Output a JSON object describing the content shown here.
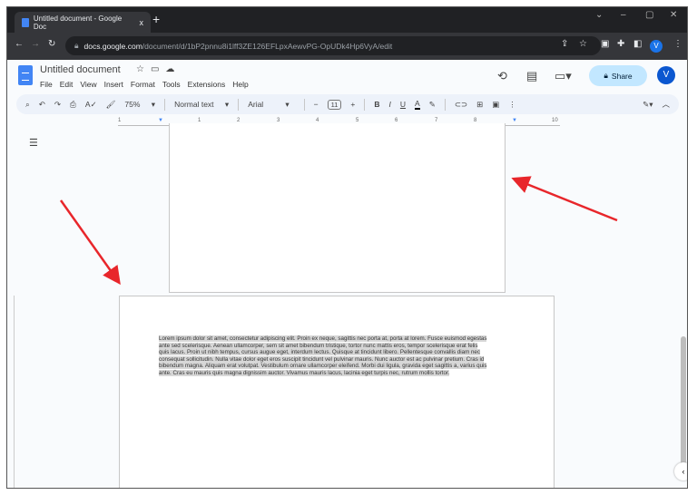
{
  "browser": {
    "tab_title": "Untitled document - Google Doc",
    "new_tab": "+",
    "close": "x",
    "window_controls": [
      "⌄",
      "–",
      "▢",
      "✕"
    ],
    "url_host": "docs.google.com",
    "url_path": "/document/d/1bP2pnnu8i1lff3ZE126EFLpxAewvPG-OpUDk4Hp6VyA/edit",
    "profile": "V"
  },
  "doc": {
    "title": "Untitled document",
    "menu": [
      "File",
      "Edit",
      "View",
      "Insert",
      "Format",
      "Tools",
      "Extensions",
      "Help"
    ],
    "share": "Share",
    "avatar": "V"
  },
  "toolbar": {
    "zoom": "75%",
    "style": "Normal text",
    "font": "Arial",
    "size": "11",
    "minus": "−",
    "plus": "+",
    "bold": "B",
    "italic": "I",
    "underline": "U",
    "color": "A"
  },
  "ruler": [
    "1",
    "1",
    "2",
    "3",
    "4",
    "5",
    "6",
    "7",
    "8",
    "9",
    "10"
  ],
  "body_lines": [
    "Lorem ipsum dolor sit amet, consectetur adipiscing elit. Proin ex neque, sagittis nec porta at, porta at lorem. Fusce euismod egestas",
    "ante sed scelerisque. Aenean ullamcorper, sem sit amet bibendum tristique, tortor nunc mattis eros, tempor scelerisque erat felis",
    "quis lacus. Proin ut nibh tempus, cursus augue eget, interdum lectus. Quisque at tincidunt libero. Pellentesque convallis diam nec",
    "consequat sollicitudin. Nulla vitae dolor eget eros suscipit tincidunt vel pulvinar mauris. Nunc auctor est ac pulvinar pretium. Cras id",
    "bibendum magna. Aliquam erat volutpat. Vestibulum ornare ullamcorper eleifend. Morbi dui ligula, gravida eget sagittis a, varius quis",
    "ante. Cras eu mauris quis magna dignissim auctor. Vivamus mauris lacus, lacinia eget turpis nec, rutrum mollis tortor."
  ],
  "colors": {
    "arrow": "#e8262b",
    "accent": "#1a73e8"
  }
}
